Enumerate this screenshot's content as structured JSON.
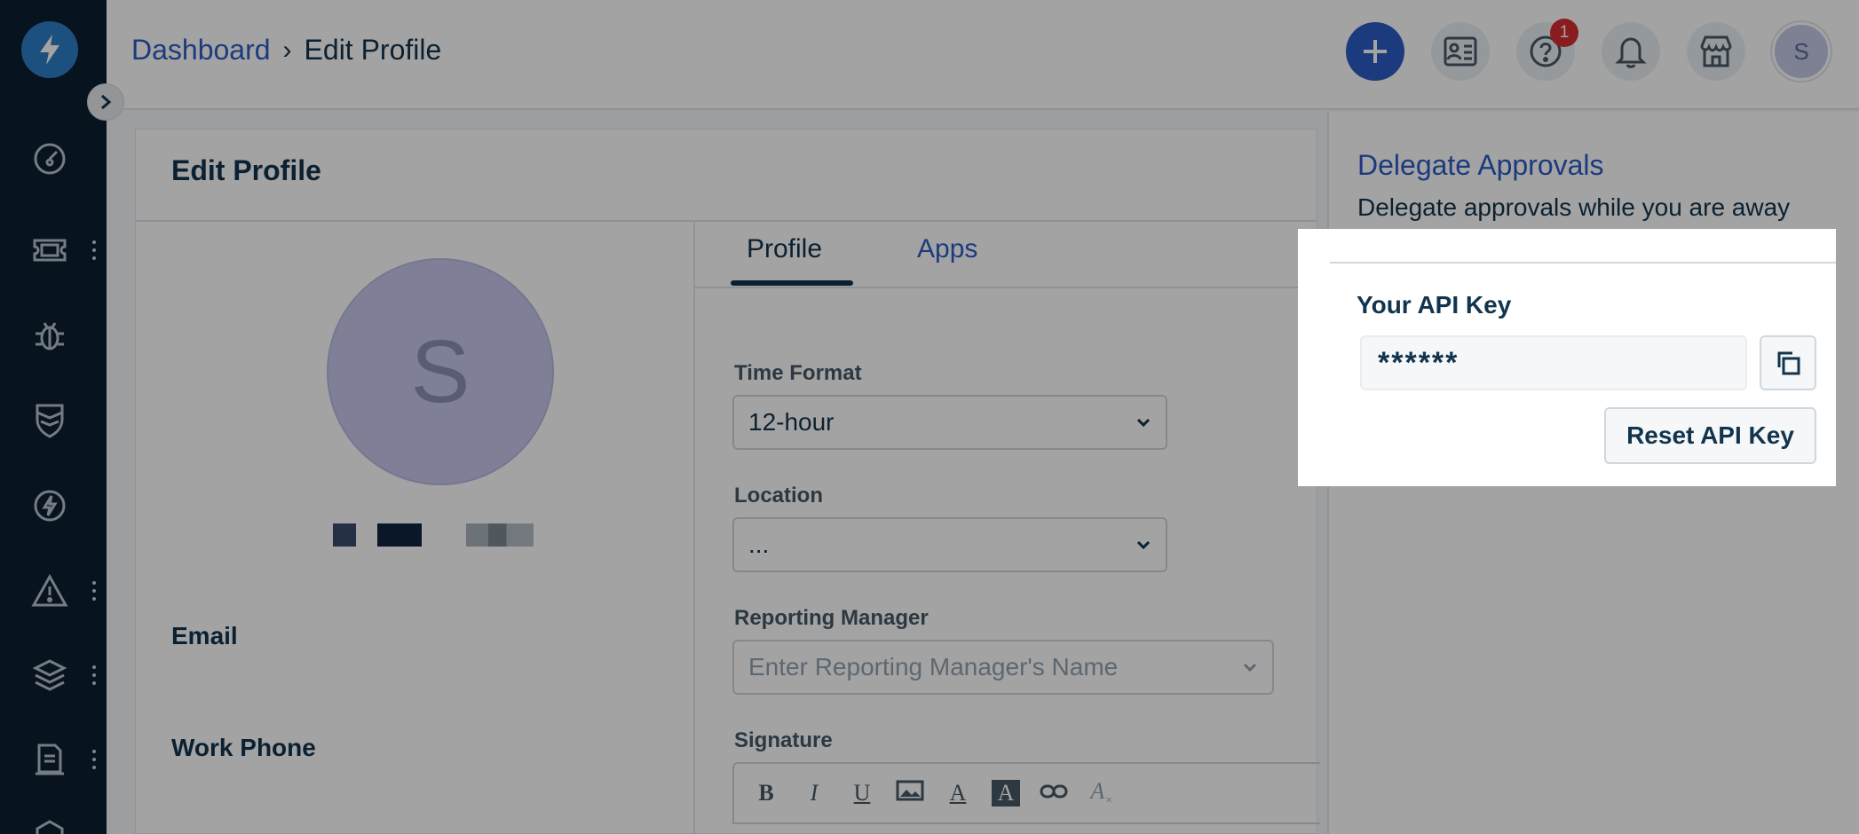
{
  "header": {
    "breadcrumb": {
      "link": "Dashboard",
      "separator": "›",
      "current": "Edit Profile"
    },
    "notification_badge": "1",
    "avatar_initial": "S",
    "buttons": [
      "plus-icon",
      "contacts-icon",
      "help-icon",
      "bell-icon",
      "store-icon"
    ]
  },
  "sidebar": {
    "items": [
      "dashboard-icon",
      "ticket-icon",
      "bug-icon",
      "shield-icon",
      "bolt-icon",
      "alert-icon",
      "layers-icon",
      "document-icon"
    ]
  },
  "profile": {
    "title": "Edit Profile",
    "avatar_initial": "S",
    "labels": {
      "email": "Email",
      "work_phone": "Work Phone"
    }
  },
  "tabs": [
    {
      "label": "Profile",
      "active": true
    },
    {
      "label": "Apps",
      "active": false
    }
  ],
  "form": {
    "time_format": {
      "label": "Time Format",
      "value": "12-hour"
    },
    "location": {
      "label": "Location",
      "value": "..."
    },
    "reporting_manager": {
      "label": "Reporting Manager",
      "placeholder": "Enter Reporting Manager's Name"
    },
    "signature": {
      "label": "Signature",
      "toolbar": [
        "B",
        "I",
        "U",
        "image",
        "A",
        "A",
        "link",
        "clear-format"
      ]
    }
  },
  "delegate": {
    "title": "Delegate Approvals",
    "subtitle": "Delegate approvals while you are away"
  },
  "api_key": {
    "title": "Your API Key",
    "value": "******",
    "reset_label": "Reset API Key"
  },
  "colors": {
    "primary": "#2c5cc5",
    "sidebar": "#0d1f33",
    "badge": "#d72d30",
    "avatar": "#c7c8ee"
  }
}
